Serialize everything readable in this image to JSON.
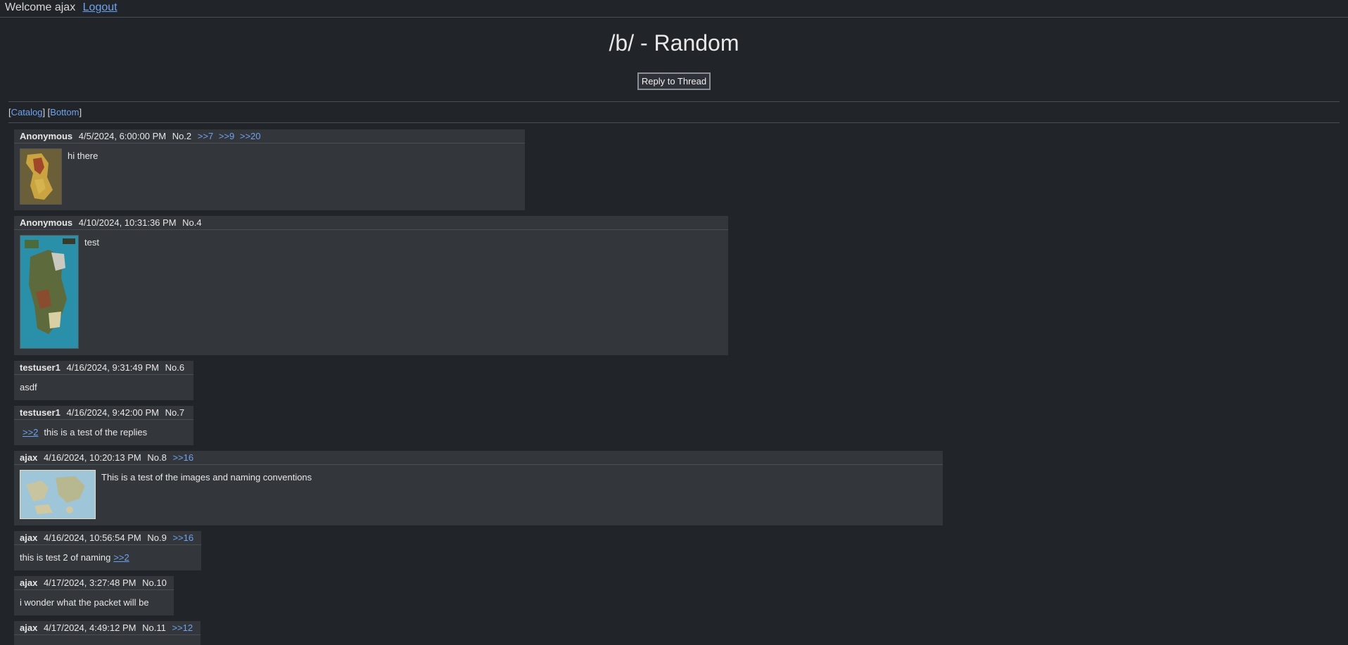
{
  "topbar": {
    "welcome": "Welcome ajax",
    "logout": "Logout"
  },
  "board": {
    "title": "/b/ - Random",
    "reply_button": "Reply to Thread"
  },
  "nav": {
    "catalog": "Catalog",
    "bottom": "Bottom"
  },
  "posts": [
    {
      "name": "Anonymous",
      "date": "4/5/2024, 6:00:00 PM",
      "no": "No.2",
      "backlinks": [
        ">>7",
        ">>9",
        ">>20"
      ],
      "body": "hi there"
    },
    {
      "name": "Anonymous",
      "date": "4/10/2024, 10:31:36 PM",
      "no": "No.4",
      "backlinks": [],
      "body": "test"
    },
    {
      "name": "testuser1",
      "date": "4/16/2024, 9:31:49 PM",
      "no": "No.6",
      "backlinks": [],
      "body": "asdf"
    },
    {
      "name": "testuser1",
      "date": "4/16/2024, 9:42:00 PM",
      "no": "No.7",
      "backlinks": [],
      "quote": ">>2",
      "body": "this is a test of the replies"
    },
    {
      "name": "ajax",
      "date": "4/16/2024, 10:20:13 PM",
      "no": "No.8",
      "backlinks": [
        ">>16"
      ],
      "body": "This is a test of the images and naming conventions"
    },
    {
      "name": "ajax",
      "date": "4/16/2024, 10:56:54 PM",
      "no": "No.9",
      "backlinks": [
        ">>16"
      ],
      "body": "this is test 2 of naming",
      "quote": ">>2"
    },
    {
      "name": "ajax",
      "date": "4/17/2024, 3:27:48 PM",
      "no": "No.10",
      "backlinks": [],
      "body": "i wonder what the packet will be"
    },
    {
      "name": "ajax",
      "date": "4/17/2024, 4:49:12 PM",
      "no": "No.11",
      "backlinks": [
        ">>12"
      ],
      "body": ""
    }
  ]
}
